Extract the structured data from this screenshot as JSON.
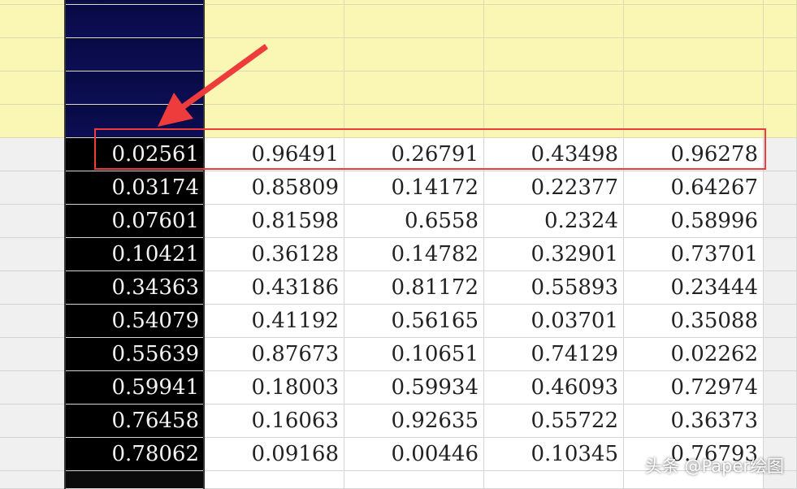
{
  "grid": {
    "rows": [
      [
        "0.02561",
        "0.96491",
        "0.26791",
        "0.43498",
        "0.96278"
      ],
      [
        "0.03174",
        "0.85809",
        "0.14172",
        "0.22377",
        "0.64267"
      ],
      [
        "0.07601",
        "0.81598",
        "0.6558",
        "0.2324",
        "0.58996"
      ],
      [
        "0.10421",
        "0.36128",
        "0.14782",
        "0.32901",
        "0.73701"
      ],
      [
        "0.34363",
        "0.43186",
        "0.81172",
        "0.55893",
        "0.23444"
      ],
      [
        "0.54079",
        "0.41192",
        "0.56165",
        "0.03701",
        "0.35088"
      ],
      [
        "0.55639",
        "0.87673",
        "0.10651",
        "0.74129",
        "0.02262"
      ],
      [
        "0.59941",
        "0.18003",
        "0.59934",
        "0.46093",
        "0.72974"
      ],
      [
        "0.76458",
        "0.16063",
        "0.92635",
        "0.55722",
        "0.36373"
      ],
      [
        "0.78062",
        "0.09168",
        "0.00446",
        "0.10345",
        "0.76793"
      ]
    ]
  },
  "colors": {
    "header_band": "#faf6b4",
    "selected_column": "#000000",
    "highlight_box": "#ee3b3b",
    "arrow": "#ee3b3b"
  },
  "watermark": {
    "text": "头条 @Paper绘图"
  }
}
